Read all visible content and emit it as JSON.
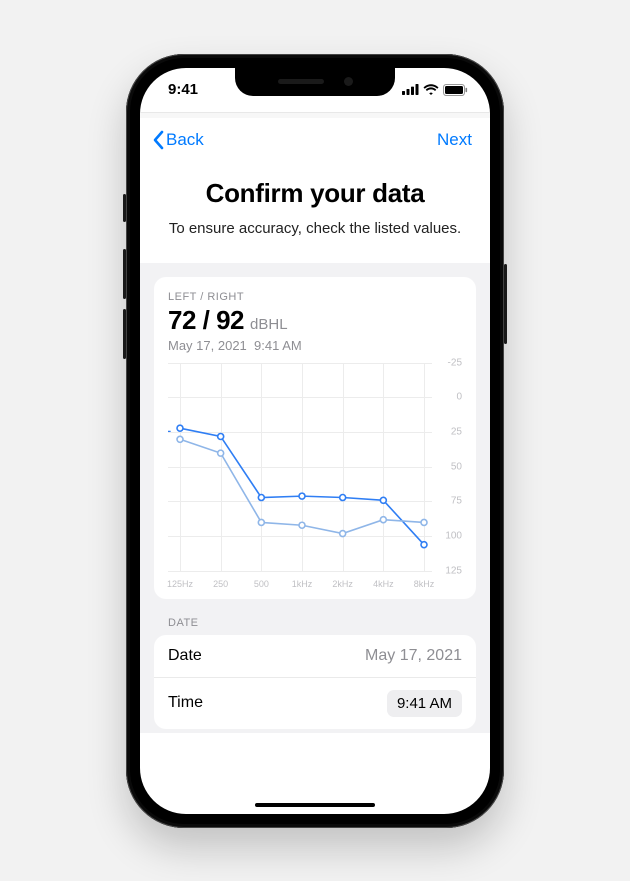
{
  "status_bar": {
    "time": "9:41"
  },
  "nav": {
    "back": "Back",
    "next": "Next"
  },
  "header": {
    "title": "Confirm your data",
    "subtitle": "To ensure accuracy, check the listed values."
  },
  "summary": {
    "legend": "LEFT / RIGHT",
    "value": "72 / 92",
    "unit": "dBHL",
    "date": "May 17, 2021",
    "time": "9:41 AM"
  },
  "chart_data": {
    "type": "line",
    "xlabel": "",
    "ylabel": "",
    "ylim": [
      -25,
      125
    ],
    "x_categories": [
      "125Hz",
      "250",
      "500",
      "1kHz",
      "2kHz",
      "4kHz",
      "8kHz"
    ],
    "y_ticks": [
      -25,
      0,
      25,
      50,
      75,
      100,
      125
    ],
    "series": [
      {
        "name": "L",
        "color": "#2f7ef4",
        "values": [
          22,
          28,
          72,
          71,
          72,
          74,
          106
        ]
      },
      {
        "name": "R",
        "color": "#8fb6e8",
        "values": [
          30,
          40,
          90,
          92,
          98,
          88,
          90
        ]
      }
    ]
  },
  "date_section": {
    "label": "DATE",
    "rows": {
      "date": {
        "label": "Date",
        "value": "May 17, 2021"
      },
      "time": {
        "label": "Time",
        "value": "9:41 AM"
      }
    }
  }
}
